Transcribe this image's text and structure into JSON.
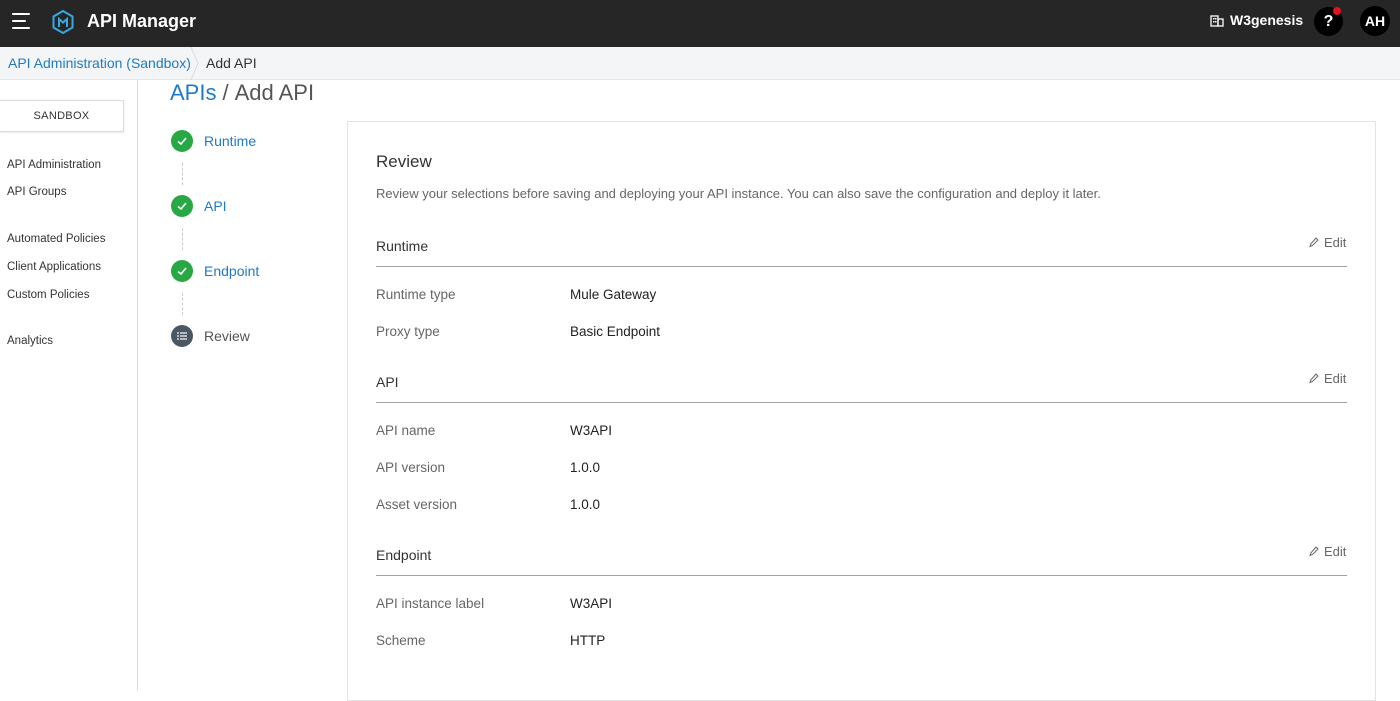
{
  "header": {
    "app_title": "API Manager",
    "org_name": "W3genesis",
    "help_label": "?",
    "user_initials": "AH"
  },
  "breadcrumb": {
    "parent": "API Administration (Sandbox)",
    "current": "Add API"
  },
  "sidebar": {
    "environment": "SANDBOX",
    "items": [
      {
        "label": "API Administration"
      },
      {
        "label": "API Groups"
      },
      {
        "label": "Automated Policies"
      },
      {
        "label": "Client Applications"
      },
      {
        "label": "Custom Policies"
      },
      {
        "label": "Analytics"
      }
    ]
  },
  "page": {
    "heading_link": "APIs",
    "heading_sep": "/",
    "heading_current": "Add API"
  },
  "stepper": [
    {
      "label": "Runtime",
      "status": "complete"
    },
    {
      "label": "API",
      "status": "complete"
    },
    {
      "label": "Endpoint",
      "status": "complete"
    },
    {
      "label": "Review",
      "status": "current"
    }
  ],
  "review": {
    "title": "Review",
    "description": "Review your selections before saving and deploying your API instance. You can also save the configuration and deploy it later.",
    "edit_label": "Edit",
    "sections": [
      {
        "title": "Runtime",
        "rows": [
          {
            "label": "Runtime type",
            "value": "Mule Gateway"
          },
          {
            "label": "Proxy type",
            "value": "Basic Endpoint"
          }
        ]
      },
      {
        "title": "API",
        "rows": [
          {
            "label": "API name",
            "value": "W3API"
          },
          {
            "label": "API version",
            "value": "1.0.0"
          },
          {
            "label": "Asset version",
            "value": "1.0.0"
          }
        ]
      },
      {
        "title": "Endpoint",
        "rows": [
          {
            "label": "API instance label",
            "value": "W3API"
          },
          {
            "label": "Scheme",
            "value": "HTTP"
          }
        ]
      }
    ]
  },
  "colors": {
    "topbar": "#262626",
    "link": "#1f7ac7",
    "success": "#27a844",
    "step_current": "#4a5866",
    "notification": "#e0141e"
  }
}
